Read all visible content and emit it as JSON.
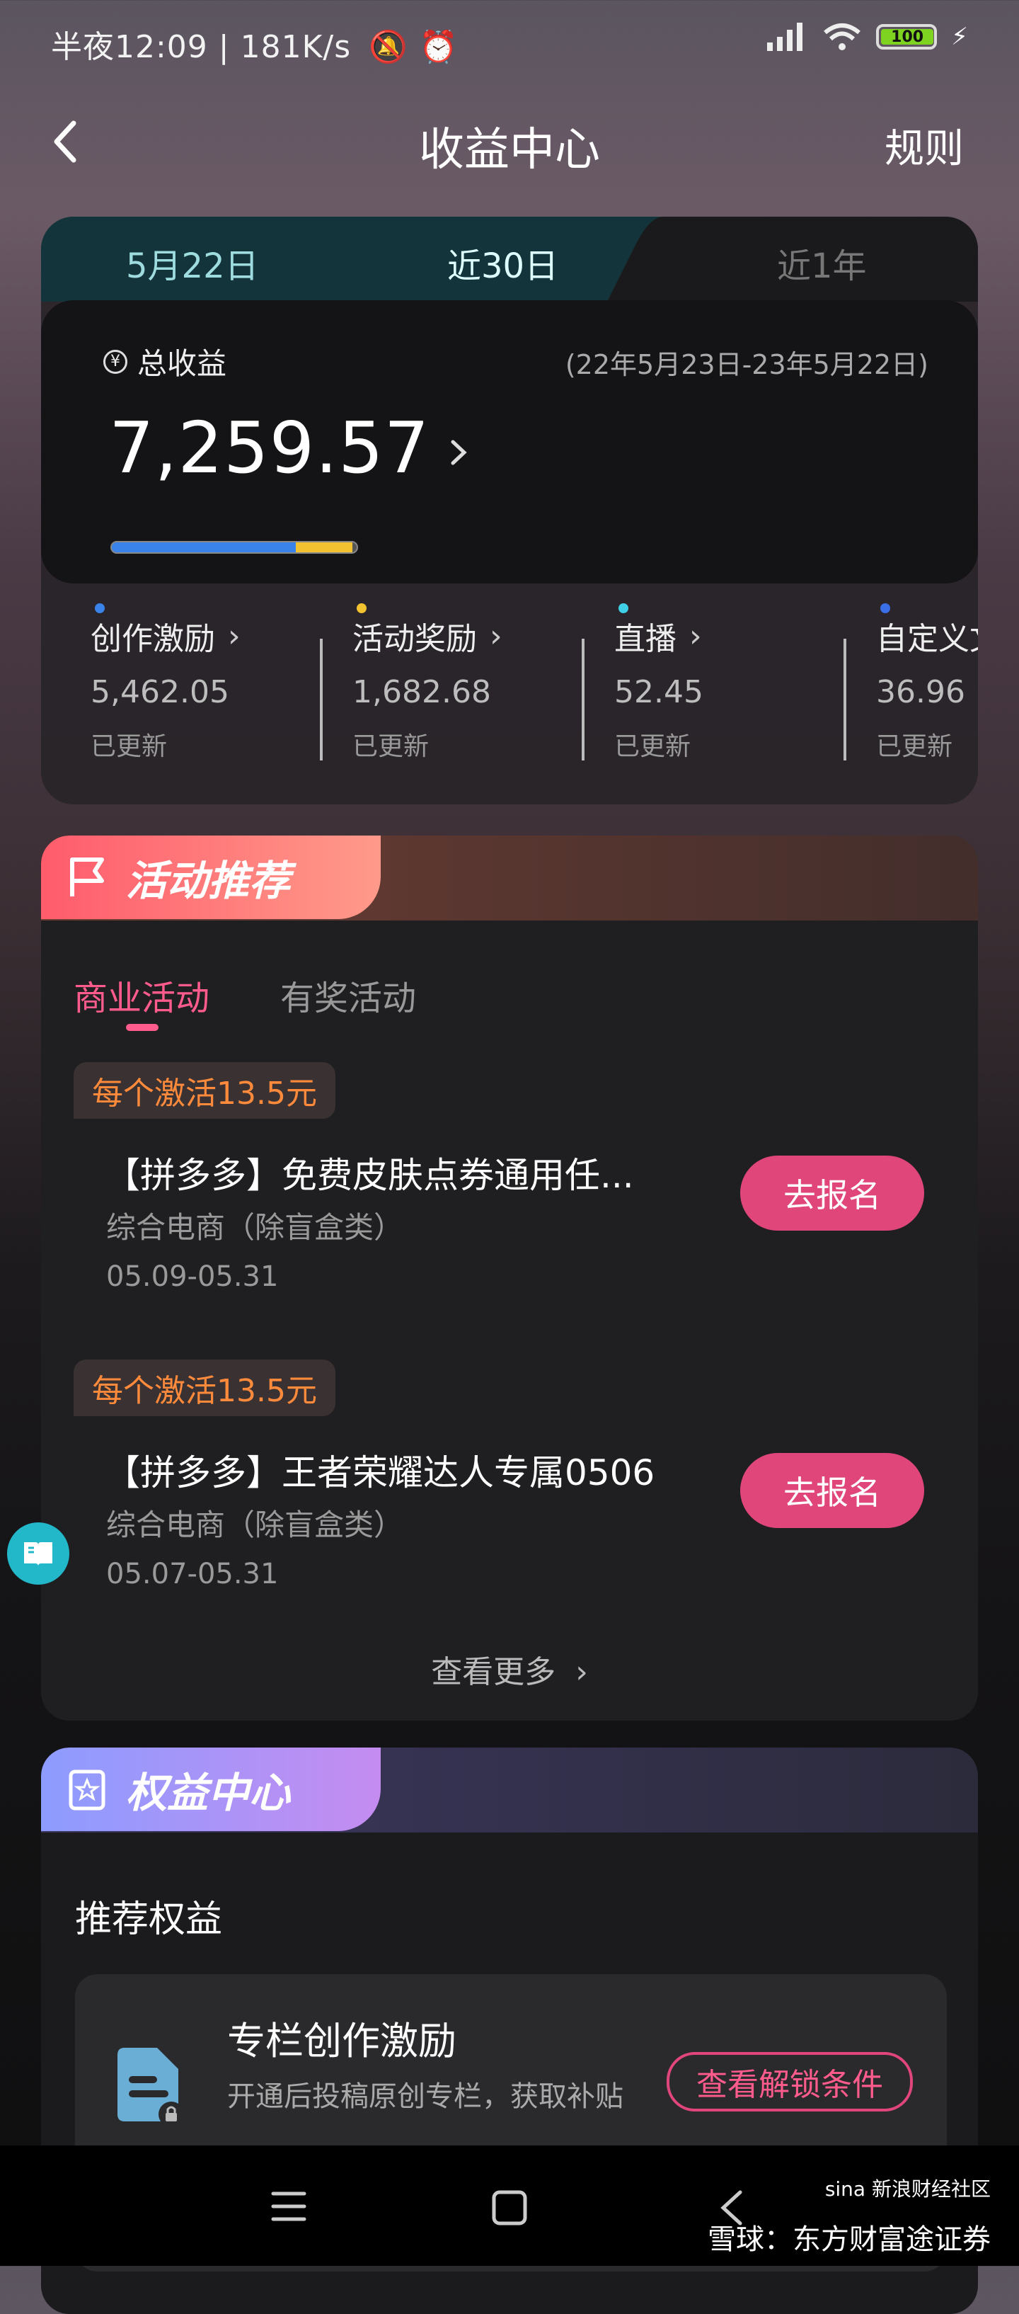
{
  "status_bar": {
    "left_text": "半夜12:09 | 181K/s",
    "battery": "100"
  },
  "header": {
    "title": "收益中心",
    "rule_label": "规则"
  },
  "income": {
    "tabs": [
      "5月22日",
      "近30日",
      "近1年"
    ],
    "total_label": "总收益",
    "period": "(22年5月23日-23年5月22日)",
    "total_amount": "7,259.57",
    "bar_fraction_blue": 0.752,
    "bar_fraction_yellow": 0.232,
    "categories": [
      {
        "name": "创作激励",
        "value": "5,462.05",
        "status": "已更新",
        "dot": "#3a83e8"
      },
      {
        "name": "活动奖励",
        "value": "1,682.68",
        "status": "已更新",
        "dot": "#f2c230"
      },
      {
        "name": "直播",
        "value": "52.45",
        "status": "已更新",
        "dot": "#3fd0e8"
      },
      {
        "name": "自定义文",
        "value": "36.96",
        "status": "已更新",
        "dot": "#3a6fe8"
      }
    ]
  },
  "activity": {
    "title": "活动推荐",
    "subtabs": [
      "商业活动",
      "有奖活动"
    ],
    "items": [
      {
        "tag": "每个激活13.5元",
        "title": "【拼多多】免费皮肤点券通用任...",
        "category": "综合电商（除盲盒类）",
        "date": "05.09-05.31",
        "button": "去报名"
      },
      {
        "tag": "每个激活13.5元",
        "title": "【拼多多】王者荣耀达人专属0506",
        "category": "综合电商（除盲盒类）",
        "date": "05.07-05.31",
        "button": "去报名"
      }
    ],
    "more": "查看更多"
  },
  "benefits": {
    "title": "权益中心",
    "recommend_title": "推荐权益",
    "item": {
      "name": "专栏创作激励",
      "desc": "开通后投稿原创专栏，获取补贴",
      "button": "查看解锁条件"
    }
  },
  "watermark": {
    "line1": "sina 新浪财经社区",
    "line2": "雪球：东方财富途证券"
  },
  "colors": {
    "accent": "#e0467a",
    "orange_tag": "#ff8a3c"
  }
}
